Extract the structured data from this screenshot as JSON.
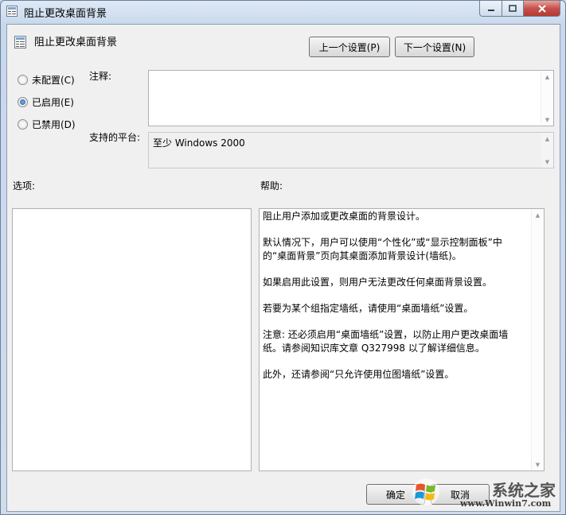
{
  "window": {
    "title": "阻止更改桌面背景"
  },
  "header": {
    "title": "阻止更改桌面背景"
  },
  "nav": {
    "prev_label": "上一个设置(P)",
    "next_label": "下一个设置(N)"
  },
  "state": {
    "options": [
      {
        "label": "未配置(C)",
        "selected": false
      },
      {
        "label": "已启用(E)",
        "selected": true
      },
      {
        "label": "已禁用(D)",
        "selected": false
      }
    ]
  },
  "comment": {
    "label": "注释:",
    "value": ""
  },
  "platform": {
    "label": "支持的平台:",
    "value": "至少 Windows 2000"
  },
  "options_label": "选项:",
  "help_label": "帮助:",
  "help": {
    "paragraphs": [
      "阻止用户添加或更改桌面的背景设计。",
      "默认情况下，用户可以使用“个性化”或“显示控制面板”中的“桌面背景”页向其桌面添加背景设计(墙纸)。",
      "如果启用此设置，则用户无法更改任何桌面背景设置。",
      "若要为某个组指定墙纸，请使用“桌面墙纸”设置。",
      "注意: 还必须启用“桌面墙纸”设置，以防止用户更改桌面墙纸。请参阅知识库文章 Q327998 以了解详细信息。",
      "此外，还请参阅“只允许使用位图墙纸”设置。"
    ]
  },
  "footer": {
    "ok_label": "确定",
    "cancel_label": "取消"
  },
  "watermark": {
    "brand": "系统之家",
    "url": "www.Winwin7.com"
  },
  "colors": {
    "accent": "#1c5a9e",
    "close_button": "#c75050"
  }
}
